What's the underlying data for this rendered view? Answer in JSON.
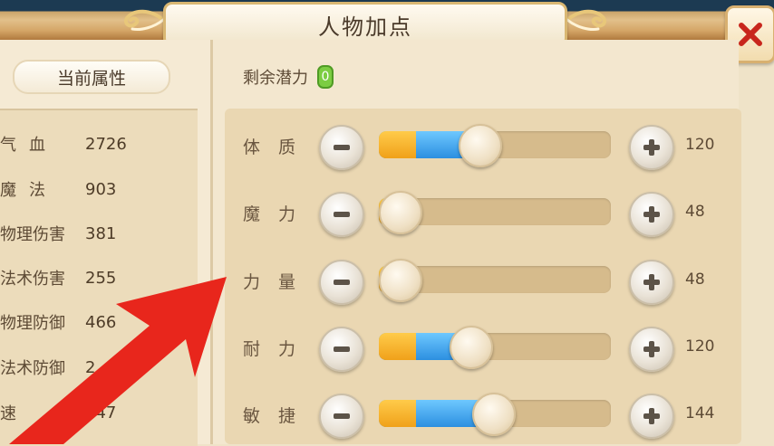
{
  "title": "人物加点",
  "left": {
    "header": "当前属性",
    "attrs": [
      {
        "label": "气血",
        "value": "2726"
      },
      {
        "label": "魔法",
        "value": "903"
      },
      {
        "label": "物理伤害",
        "value": "381"
      },
      {
        "label": "法术伤害",
        "value": "255"
      },
      {
        "label": "物理防御",
        "value": "466"
      },
      {
        "label": "法术防御",
        "value": "2"
      },
      {
        "label": "速",
        "value": "347"
      }
    ]
  },
  "right": {
    "remain_label": "剩余潜力",
    "remain_value": "0",
    "stats": [
      {
        "name": "体质",
        "value": "120",
        "base_fill": 0.16,
        "added_fill": 0.27
      },
      {
        "name": "魔力",
        "value": "48",
        "base_fill": 0.07,
        "added_fill": 0
      },
      {
        "name": "力量",
        "value": "48",
        "base_fill": 0.07,
        "added_fill": 0
      },
      {
        "name": "耐力",
        "value": "120",
        "base_fill": 0.16,
        "added_fill": 0.23
      },
      {
        "name": "敏捷",
        "value": "144",
        "base_fill": 0.16,
        "added_fill": 0.33
      }
    ]
  },
  "colors": {
    "fill_orange": "#f0a11a",
    "fill_blue": "#2c8fe0",
    "arrow": "#e8261c",
    "close_x": "#c8261c",
    "remain_badge": "#7ccd42"
  }
}
